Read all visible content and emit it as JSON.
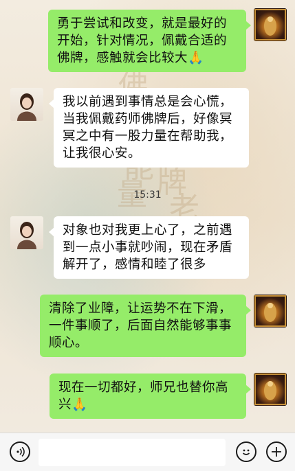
{
  "background": {
    "watermark_chars": [
      "佛",
      "牌",
      "能",
      "量",
      "老"
    ]
  },
  "messages": [
    {
      "side": "right",
      "text": "勇于尝试和改变，就是最好的开始，针对情况，佩戴合适的佛牌，感触就会比较大🙏"
    },
    {
      "side": "left",
      "text": "我以前遇到事情总是会心慌，当我佩戴药师佛牌后，好像冥冥之中有一股力量在帮助我，让我很心安。"
    },
    {
      "side": "left",
      "text": "对象也对我更上心了，之前遇到一点小事就吵闹，现在矛盾解开了，感情和睦了很多"
    },
    {
      "side": "right",
      "text": "清除了业障，让运势不在下滑，一件事顺了，后面自然能够事事顺心。"
    },
    {
      "side": "right",
      "text": "现在一切都好，师兄也替你高兴🙏"
    }
  ],
  "timestamp": "15:31",
  "input_bar": {
    "voice_icon": "voice-icon",
    "emoji_icon": "emoji-icon",
    "more_icon": "plus-icon",
    "field_value": ""
  },
  "colors": {
    "sent_bubble": "#95ec69",
    "received_bubble": "#ffffff"
  }
}
